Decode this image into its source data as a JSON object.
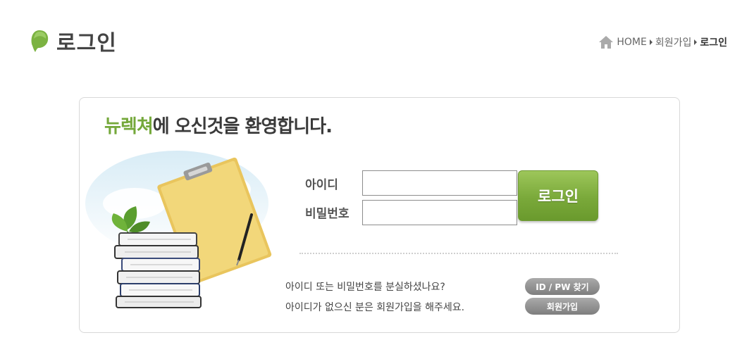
{
  "header": {
    "title": "로그인"
  },
  "breadcrumb": {
    "home": "HOME",
    "parent": "회원가입",
    "current": "로그인"
  },
  "login": {
    "welcome_brand": "뉴렉쳐",
    "welcome_rest": "에 오신것을 환영합니다.",
    "id_label": "아이디",
    "pw_label": "비밀번호",
    "id_value": "",
    "pw_value": "",
    "login_button": "로그인",
    "find_text": "아이디 또는 비밀번호를 분실하셨나요?",
    "find_button": "ID / PW 찾기",
    "join_text": "아이디가 없으신 분은 회원가입을 해주세요.",
    "join_button": "회원가입"
  },
  "colors": {
    "brand_green": "#74a83a",
    "button_green": "#7aa93a",
    "pill_gray": "#8e8e8e"
  }
}
